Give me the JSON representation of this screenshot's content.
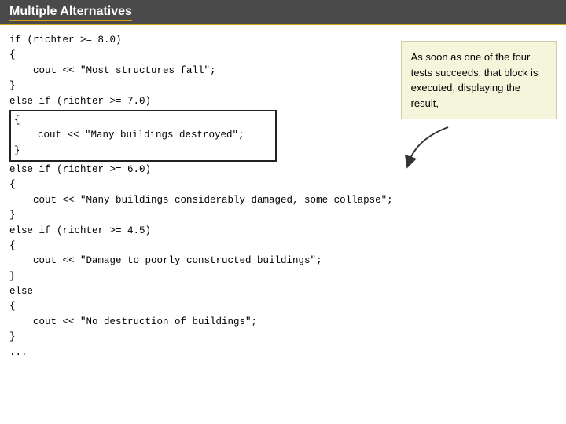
{
  "header": {
    "title": "Multiple Alternatives"
  },
  "code": {
    "lines": [
      "if (richter >= 8.0)",
      "{",
      "    cout << \"Most structures fall\";",
      "}",
      "else if (richter >= 7.0)"
    ],
    "highlighted": [
      "{",
      "    cout << \"Many buildings destroyed\";",
      "}"
    ],
    "lines2": [
      "else if (richter >= 6.0)",
      "{",
      "    cout << \"Many buildings considerably damaged, some collapse\";",
      "}",
      "else if (richter >= 4.5)",
      "{",
      "    cout << \"Damage to poorly constructed buildings\";",
      "}",
      "else",
      "{",
      "    cout << \"No destruction of buildings\";",
      "}",
      "..."
    ]
  },
  "annotation": {
    "text": "As soon as one of the four tests succeeds, that block is executed, displaying the result,"
  }
}
